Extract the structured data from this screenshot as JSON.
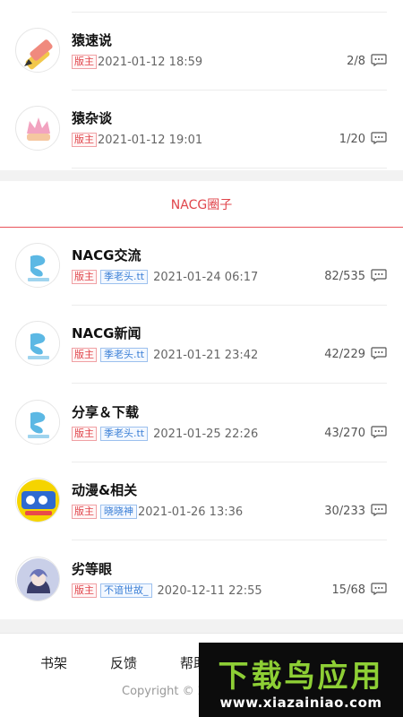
{
  "top_list": [
    {
      "title": "猿速说",
      "mod_tag": "版主",
      "time": "2021-01-12 18:59",
      "count": "2/8",
      "avatar_icon": "pencil-icon"
    },
    {
      "title": "猿杂谈",
      "mod_tag": "版主",
      "time": "2021-01-12 19:01",
      "count": "1/20",
      "avatar_icon": "crown-icon"
    }
  ],
  "section": {
    "title": "NACG圈子"
  },
  "forum_list": [
    {
      "title": "NACG交流",
      "mod_tag": "版主",
      "moderator": "季老头.tt",
      "time": "2021-01-24 06:17",
      "count": "82/535",
      "avatar_icon": "nacg-logo-icon"
    },
    {
      "title": "NACG新闻",
      "mod_tag": "版主",
      "moderator": "季老头.tt",
      "time": "2021-01-21 23:42",
      "count": "42/229",
      "avatar_icon": "nacg-logo-icon"
    },
    {
      "title": "分享＆下载",
      "mod_tag": "版主",
      "moderator": "季老头.tt",
      "time": "2021-01-25 22:26",
      "count": "43/270",
      "avatar_icon": "nacg-logo-icon"
    },
    {
      "title": "动漫&相关",
      "mod_tag": "版主",
      "moderator": "晓晓神",
      "time": "2021-01-26 13:36",
      "count": "30/233",
      "avatar_icon": "anime-badge-icon"
    },
    {
      "title": "劣等眼",
      "mod_tag": "版主",
      "moderator": "不谙世故_",
      "time": "2020-12-11 22:55",
      "count": "15/68",
      "avatar_icon": "anime-girl-icon"
    }
  ],
  "footer": {
    "links": [
      "书架",
      "反馈",
      "帮助"
    ],
    "copyright": "Copyright © 20"
  },
  "watermark": {
    "title": "下载鸟应用",
    "url": "www.xiazainiao.com"
  },
  "colors": {
    "accent": "#e0454b",
    "link": "#3b7fd6",
    "watermark_green": "#8ecf35"
  }
}
